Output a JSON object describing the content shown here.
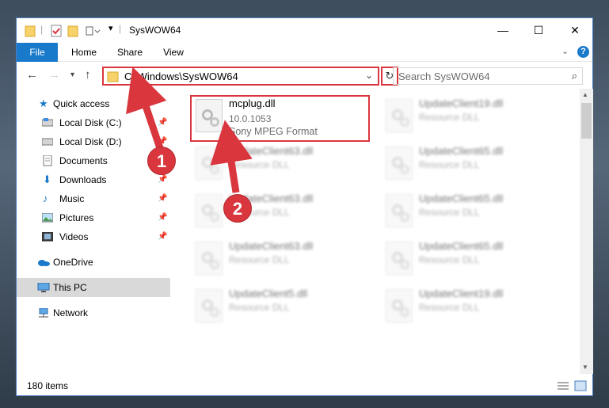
{
  "window": {
    "title": "SysWOW64",
    "minimize": "—",
    "maximize": "☐",
    "close": "✕",
    "help": "?"
  },
  "ribbon": {
    "tabs": [
      {
        "label": "File"
      },
      {
        "label": "Home"
      },
      {
        "label": "Share"
      },
      {
        "label": "View"
      }
    ]
  },
  "navbar": {
    "address": "C:\\Windows\\SysWOW64",
    "search_placeholder": "Search SysWOW64"
  },
  "sidebar": {
    "items": [
      {
        "label": "Quick access",
        "icon": "star-icon"
      },
      {
        "label": "Local Disk (C:)",
        "icon": "drive-icon",
        "pinned": true
      },
      {
        "label": "Local Disk (D:)",
        "icon": "drive-icon",
        "pinned": true
      },
      {
        "label": "Documents",
        "icon": "documents-icon",
        "pinned": true
      },
      {
        "label": "Downloads",
        "icon": "downloads-icon",
        "pinned": true
      },
      {
        "label": "Music",
        "icon": "music-icon",
        "pinned": true
      },
      {
        "label": "Pictures",
        "icon": "pictures-icon",
        "pinned": true
      },
      {
        "label": "Videos",
        "icon": "videos-icon",
        "pinned": true
      },
      {
        "label": "OneDrive",
        "icon": "onedrive-icon"
      },
      {
        "label": "This PC",
        "icon": "computer-icon",
        "selected": true
      },
      {
        "label": "Network",
        "icon": "network-icon"
      }
    ]
  },
  "files": [
    {
      "name": "mcplug.dll",
      "line1": "10.0.1053",
      "line2": "Sony MPEG Format"
    },
    {
      "name": "UpdateClient19.dll",
      "line1": "Resource DLL"
    },
    {
      "name": "UpdateClient63.dll",
      "line1": "Resource DLL"
    },
    {
      "name": "UpdateClient65.dll",
      "line1": "Resource DLL"
    },
    {
      "name": "UpdateClient63.dll",
      "line1": "Resource DLL"
    },
    {
      "name": "UpdateClient65.dll",
      "line1": "Resource DLL"
    },
    {
      "name": "UpdateClient63.dll",
      "line1": "Resource DLL"
    },
    {
      "name": "UpdateClient65.dll",
      "line1": "Resource DLL"
    },
    {
      "name": "UpdateClient5.dll",
      "line1": "Resource DLL"
    },
    {
      "name": "UpdateClient19.dll",
      "line1": "Resource DLL"
    }
  ],
  "status": {
    "items_count": "180 items"
  },
  "annotations": {
    "badge1": "1",
    "badge2": "2"
  },
  "colors": {
    "accent": "#1979ca",
    "highlight": "#d9363e"
  }
}
